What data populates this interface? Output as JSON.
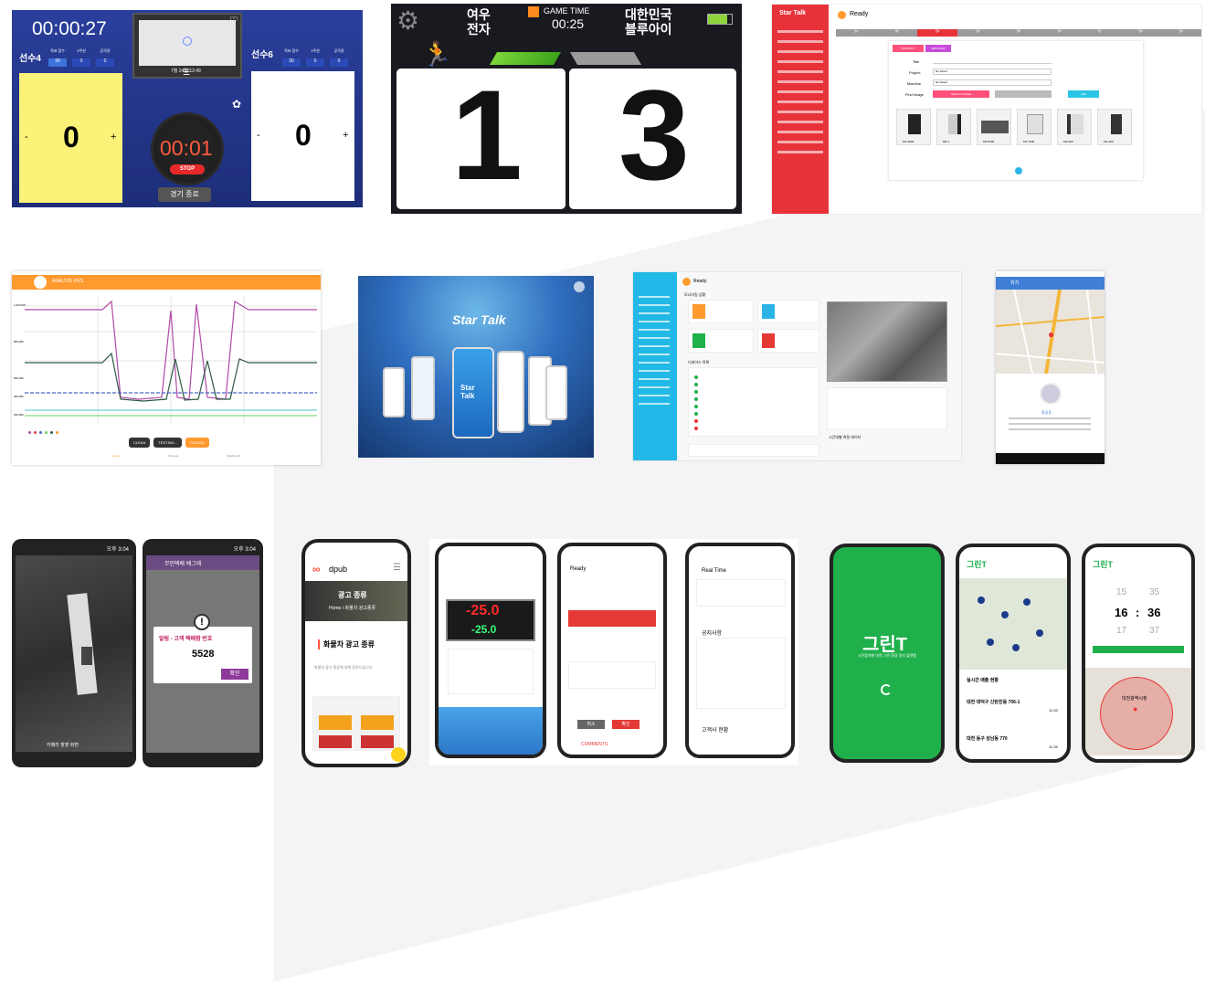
{
  "scoreboard1": {
    "timer": "00:00:27",
    "left_player": "선수4",
    "right_player": "선수6",
    "col_labels": [
      "목표 점수",
      "3쿠션",
      "공격권"
    ],
    "left_vals": [
      "30",
      "0",
      "0"
    ],
    "right_vals": [
      "30",
      "0",
      "0"
    ],
    "left_score": "0",
    "right_score": "0",
    "countdown": "00:01",
    "stop_label": "STOP",
    "end_label": "경기 종료",
    "minus": "-",
    "plus": "+",
    "preview_caption": "7월 24일 12:49"
  },
  "scoreboard2": {
    "team_left": "여우\n전자",
    "game_time_label": "GAME TIME",
    "game_time": "00:25",
    "team_right": "대한민국\n블루아이",
    "score_left": "1",
    "score_right": "3"
  },
  "startalk_admin": {
    "logo": "Star Talk",
    "status": "Ready",
    "tabs": [
      "탭1",
      "탭2",
      "탭3",
      "탭4",
      "탭5",
      "탭6",
      "탭7",
      "탭8",
      "탭9"
    ],
    "btn_pink1": "PRODUCT",
    "btn_purple": "REGISTER",
    "form_labels": [
      "Title",
      "Project",
      "Machine",
      "Find Image"
    ],
    "select_placeholder": "No Select",
    "btn_select_image": "SELECT IMAGE",
    "btn_add": "ADD",
    "products": [
      "MX-3000",
      "MP-1",
      "MX-5000",
      "MX-7000",
      "MX-600",
      "MX-400"
    ]
  },
  "monitor_chart": {
    "title": "ANALYZE PRS",
    "buttons": [
      "CLEAN",
      "TESTING...",
      "CANCEL"
    ],
    "bottom_nav": [
      "Home",
      "Progress",
      "Dashboard"
    ],
    "y_labels": [
      "1,000,000",
      "800,000",
      "600,000",
      "400,000",
      "200,000"
    ]
  },
  "startalk_splash": {
    "logo": "Star Talk",
    "phone_logo": "Star\nTalk"
  },
  "dashboard": {
    "status": "Ready",
    "section": "모니터링 상황",
    "list_title": "디바이스 목록",
    "chart_title": "시간대별 측정 데이터"
  },
  "map_app": {
    "title": "위치",
    "name": "홍길동"
  },
  "delivery_app": {
    "alert_title": "알림 - 고객 택배함 번호",
    "code": "5528",
    "confirm": "확인",
    "header": "무인택배 배그래",
    "status_time": "오후 3:04",
    "caption": "카메라 촬영 화면"
  },
  "dpub": {
    "logo": "dpub",
    "hero_title": "광고 종류",
    "breadcrumb": "Home / 화물차 광고종류",
    "section_title": "화물차 광고 종류",
    "body": "화물차 광고 종류에 대해 알려드립니다."
  },
  "iot_app": {
    "temp1": "-25.0",
    "temp2": "-25.0",
    "ready": "Ready",
    "realtime": "Real Time",
    "notice": "공지사항",
    "product_status": "고객사 현황",
    "btn_ok": "확인",
    "btn_cancel": "취소",
    "comments": "COMMENTS"
  },
  "greent": {
    "logo": "그린T",
    "tagline": "시민참여형 대전 그린 환경 정보 플랫폼",
    "time_hour": "16",
    "time_min": "36",
    "time_prev_h": "15",
    "time_prev_m": "35",
    "time_next_h": "17",
    "time_next_m": "37",
    "city_hall": "대전광역시청",
    "list_header": "실시간 매출 현황",
    "list_items": [
      "대전 대덕구 신탄진동 706-1",
      "대전 동구 성남동 770"
    ],
    "list_values": [
      "11.35",
      "11.35"
    ]
  },
  "colors": {
    "sb_blue": "#1f3a8a",
    "yellow": "#fbf27a",
    "orange": "#ff9a2e",
    "red": "#e53935",
    "green": "#1fb04b",
    "cyan": "#2bb4e6",
    "purple": "#8e5a9b"
  }
}
